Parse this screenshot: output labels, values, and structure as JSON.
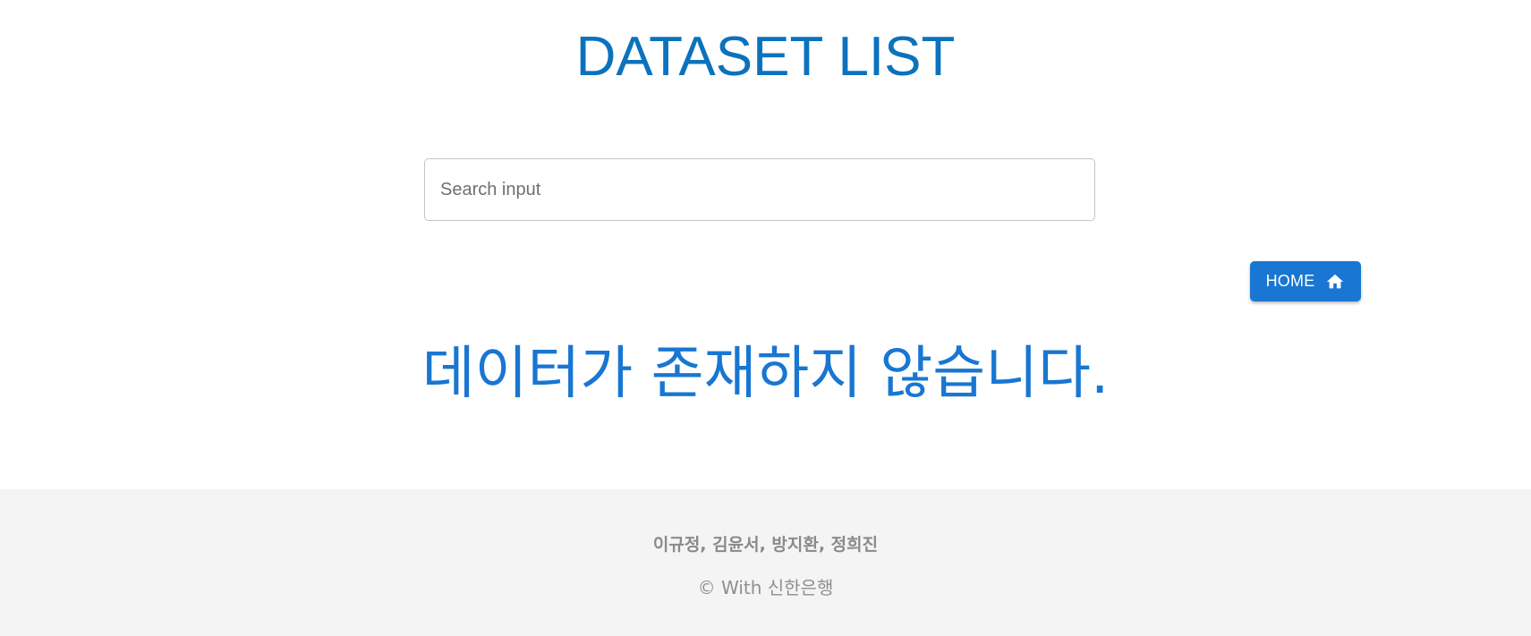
{
  "header": {
    "title": "DATASET LIST"
  },
  "search": {
    "placeholder": "Search input",
    "value": ""
  },
  "actions": {
    "home_label": "HOME",
    "home_icon": "home-icon"
  },
  "content": {
    "empty_message": "데이터가 존재하지 않습니다."
  },
  "footer": {
    "authors": "이규정, 김윤서, 방지환, 정희진",
    "copyright": "© With 신한은행"
  },
  "colors": {
    "title": "#0b72bd",
    "accent": "#1976d2",
    "footer_bg": "#f4f4f4",
    "footer_text": "#8a8a8a"
  }
}
